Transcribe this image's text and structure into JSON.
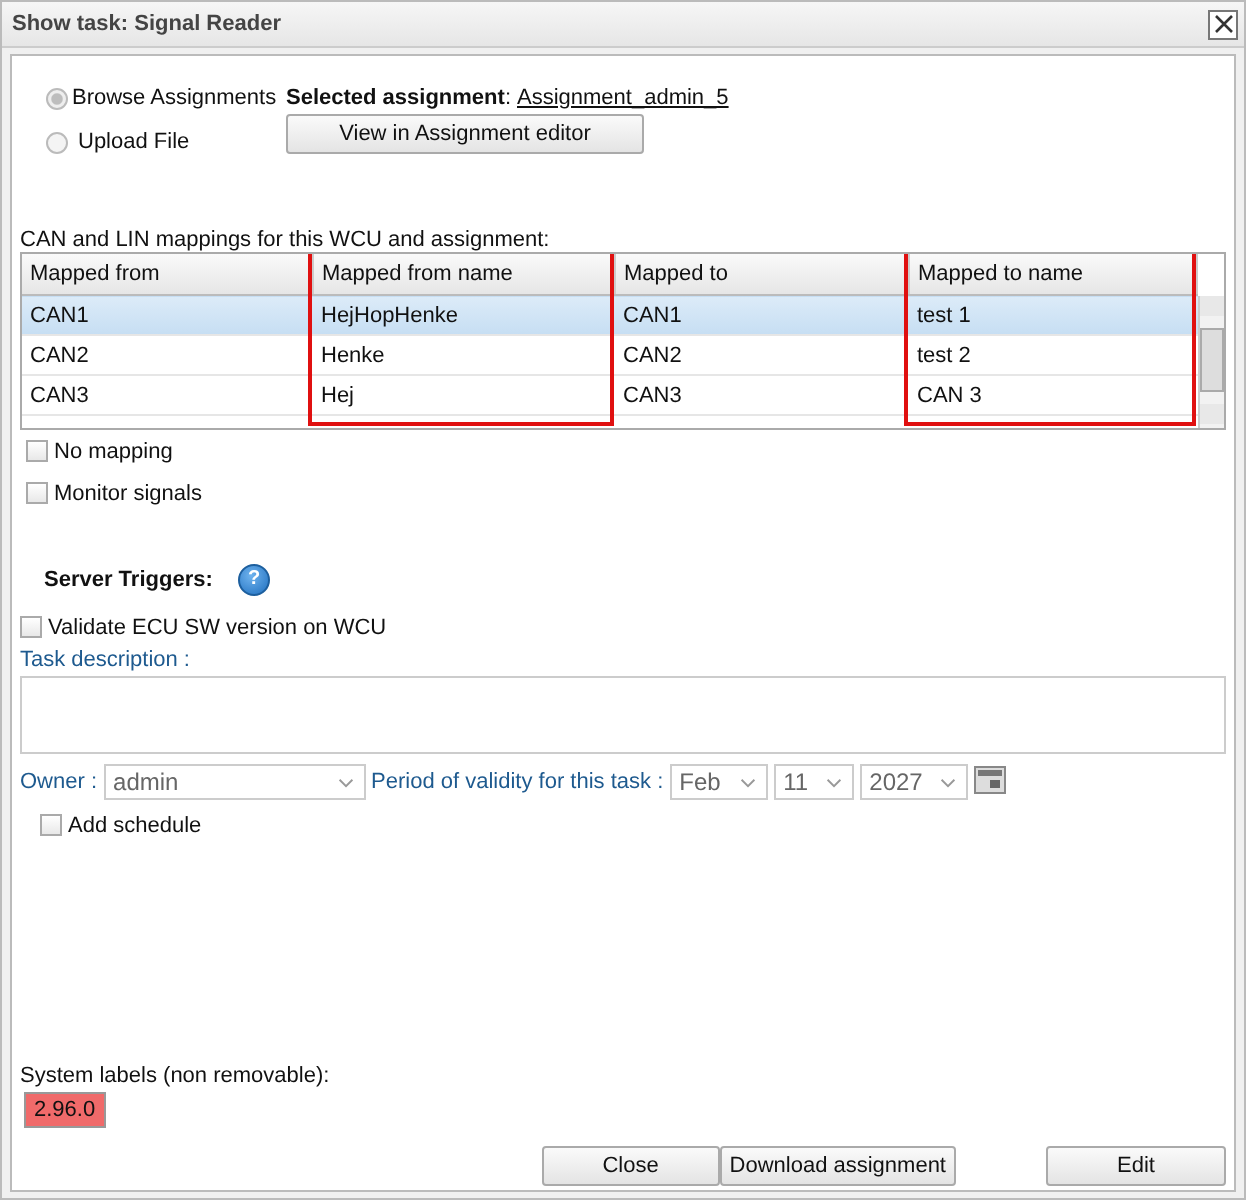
{
  "window": {
    "title": "Show task: Signal Reader"
  },
  "source": [
    {
      "label": "Browse Assignments",
      "selected": true
    },
    {
      "label": "Upload File",
      "selected": false
    }
  ],
  "selected_assignment": {
    "label": "**Selected assignment**:",
    "value": "Assignment_admin_5"
  },
  "view_button": "View in Assignment editor",
  "mappings": {
    "caption": "CAN and LIN mappings for this WCU and assignment:",
    "columns": [
      {
        "label": "Mapped from",
        "highlighted": false
      },
      {
        "label": "Mapped from name",
        "highlighted": true
      },
      {
        "label": "Mapped to",
        "highlighted": false
      },
      {
        "label": "Mapped to name",
        "highlighted": true
      }
    ],
    "rows": [
      {
        "cells": [
          "CAN1",
          "HejHopHenke",
          "CAN1",
          "test 1"
        ],
        "selected": true
      },
      {
        "cells": [
          "CAN2",
          "Henke",
          "CAN2",
          "test 2"
        ],
        "selected": false
      },
      {
        "cells": [
          "CAN3",
          "Hej",
          "CAN3",
          "CAN 3"
        ],
        "selected": false
      }
    ]
  },
  "options": [
    {
      "label": "No mapping",
      "checked": false
    },
    {
      "label": "Monitor signals",
      "checked": false
    }
  ],
  "server_triggers": {
    "label": "Server Triggers:",
    "help": "?",
    "checks": [
      {
        "label": "Validate ECU SW version on WCU",
        "checked": false
      }
    ]
  },
  "task_description": {
    "label": "Task description :"
  },
  "owner": {
    "label": "Owner :",
    "value": "admin"
  },
  "validity": {
    "label": "Period of validity for this task :",
    "month": "Feb",
    "day": "11",
    "year": "2027"
  },
  "schedule": {
    "label": "Add schedule",
    "checked": false
  },
  "system_labels": {
    "label": "System labels (non removable):",
    "tags": [
      {
        "text": "2.96.0",
        "color": "#f06a6a"
      }
    ]
  },
  "buttons": [
    "Close",
    "Download assignment",
    "Edit"
  ]
}
